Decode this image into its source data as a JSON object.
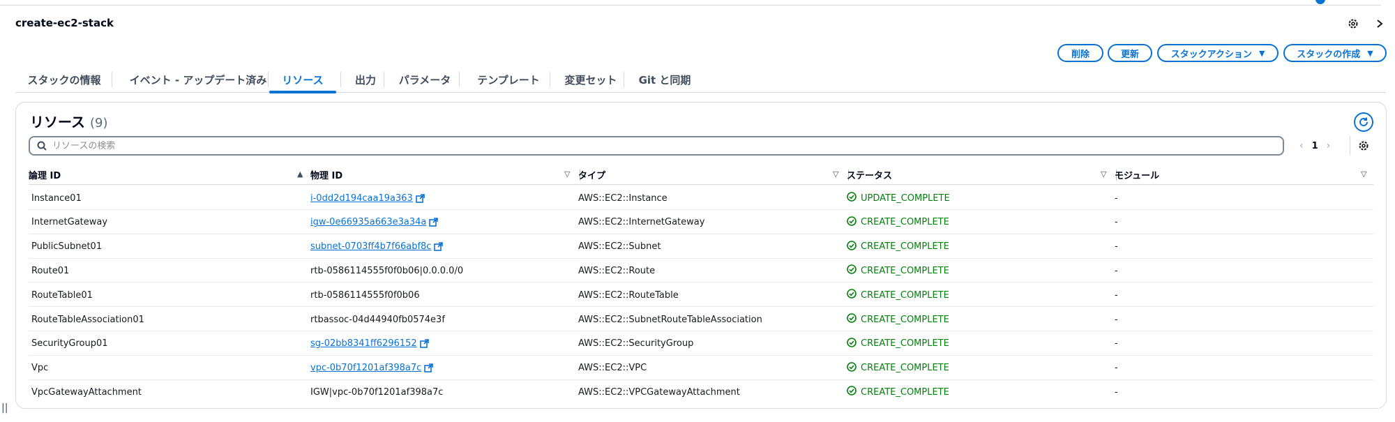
{
  "page": {
    "title": "create-ec2-stack"
  },
  "actions": {
    "delete": "削除",
    "update": "更新",
    "stack_actions": "スタックアクション",
    "create_stack": "スタックの作成"
  },
  "tabs": [
    {
      "label": "スタックの情報",
      "active": false
    },
    {
      "label": "イベント - アップデート済み",
      "active": false
    },
    {
      "label": "リソース",
      "active": true
    },
    {
      "label": "出力",
      "active": false
    },
    {
      "label": "パラメータ",
      "active": false
    },
    {
      "label": "テンプレート",
      "active": false
    },
    {
      "label": "変更セット",
      "active": false
    },
    {
      "label": "Git と同期",
      "active": false
    }
  ],
  "resources": {
    "title": "リソース",
    "count": "(9)",
    "search_placeholder": "リソースの検索",
    "page_number": "1",
    "columns": [
      "論理 ID",
      "物理 ID",
      "タイプ",
      "ステータス",
      "モジュール"
    ],
    "rows": [
      {
        "logical_id": "Instance01",
        "physical_id": "i-0dd2d194caa19a363",
        "physical_is_link": true,
        "type": "AWS::EC2::Instance",
        "status": "UPDATE_COMPLETE",
        "module": "-"
      },
      {
        "logical_id": "InternetGateway",
        "physical_id": "igw-0e66935a663e3a34a",
        "physical_is_link": true,
        "type": "AWS::EC2::InternetGateway",
        "status": "CREATE_COMPLETE",
        "module": "-"
      },
      {
        "logical_id": "PublicSubnet01",
        "physical_id": "subnet-0703ff4b7f66abf8c",
        "physical_is_link": true,
        "type": "AWS::EC2::Subnet",
        "status": "CREATE_COMPLETE",
        "module": "-"
      },
      {
        "logical_id": "Route01",
        "physical_id": "rtb-0586114555f0f0b06|0.0.0.0/0",
        "physical_is_link": false,
        "type": "AWS::EC2::Route",
        "status": "CREATE_COMPLETE",
        "module": "-"
      },
      {
        "logical_id": "RouteTable01",
        "physical_id": "rtb-0586114555f0f0b06",
        "physical_is_link": false,
        "type": "AWS::EC2::RouteTable",
        "status": "CREATE_COMPLETE",
        "module": "-"
      },
      {
        "logical_id": "RouteTableAssociation01",
        "physical_id": "rtbassoc-04d44940fb0574e3f",
        "physical_is_link": false,
        "type": "AWS::EC2::SubnetRouteTableAssociation",
        "status": "CREATE_COMPLETE",
        "module": "-"
      },
      {
        "logical_id": "SecurityGroup01",
        "physical_id": "sg-02bb8341ff6296152",
        "physical_is_link": true,
        "type": "AWS::EC2::SecurityGroup",
        "status": "CREATE_COMPLETE",
        "module": "-"
      },
      {
        "logical_id": "Vpc",
        "physical_id": "vpc-0b70f1201af398a7c",
        "physical_is_link": true,
        "type": "AWS::EC2::VPC",
        "status": "CREATE_COMPLETE",
        "module": "-"
      },
      {
        "logical_id": "VpcGatewayAttachment",
        "physical_id": "IGW|vpc-0b70f1201af398a7c",
        "physical_is_link": false,
        "type": "AWS::EC2::VPCGatewayAttachment",
        "status": "CREATE_COMPLETE",
        "module": "-"
      }
    ]
  },
  "colors": {
    "accent": "#0972d3",
    "success": "#037f0c",
    "border": "#d5dbdb"
  },
  "icons": {
    "settings": "gear-icon",
    "collapse": "chevron-right-icon",
    "refresh": "refresh-icon",
    "search": "search-icon",
    "external": "external-link-icon",
    "status_ok": "check-circle-icon"
  }
}
